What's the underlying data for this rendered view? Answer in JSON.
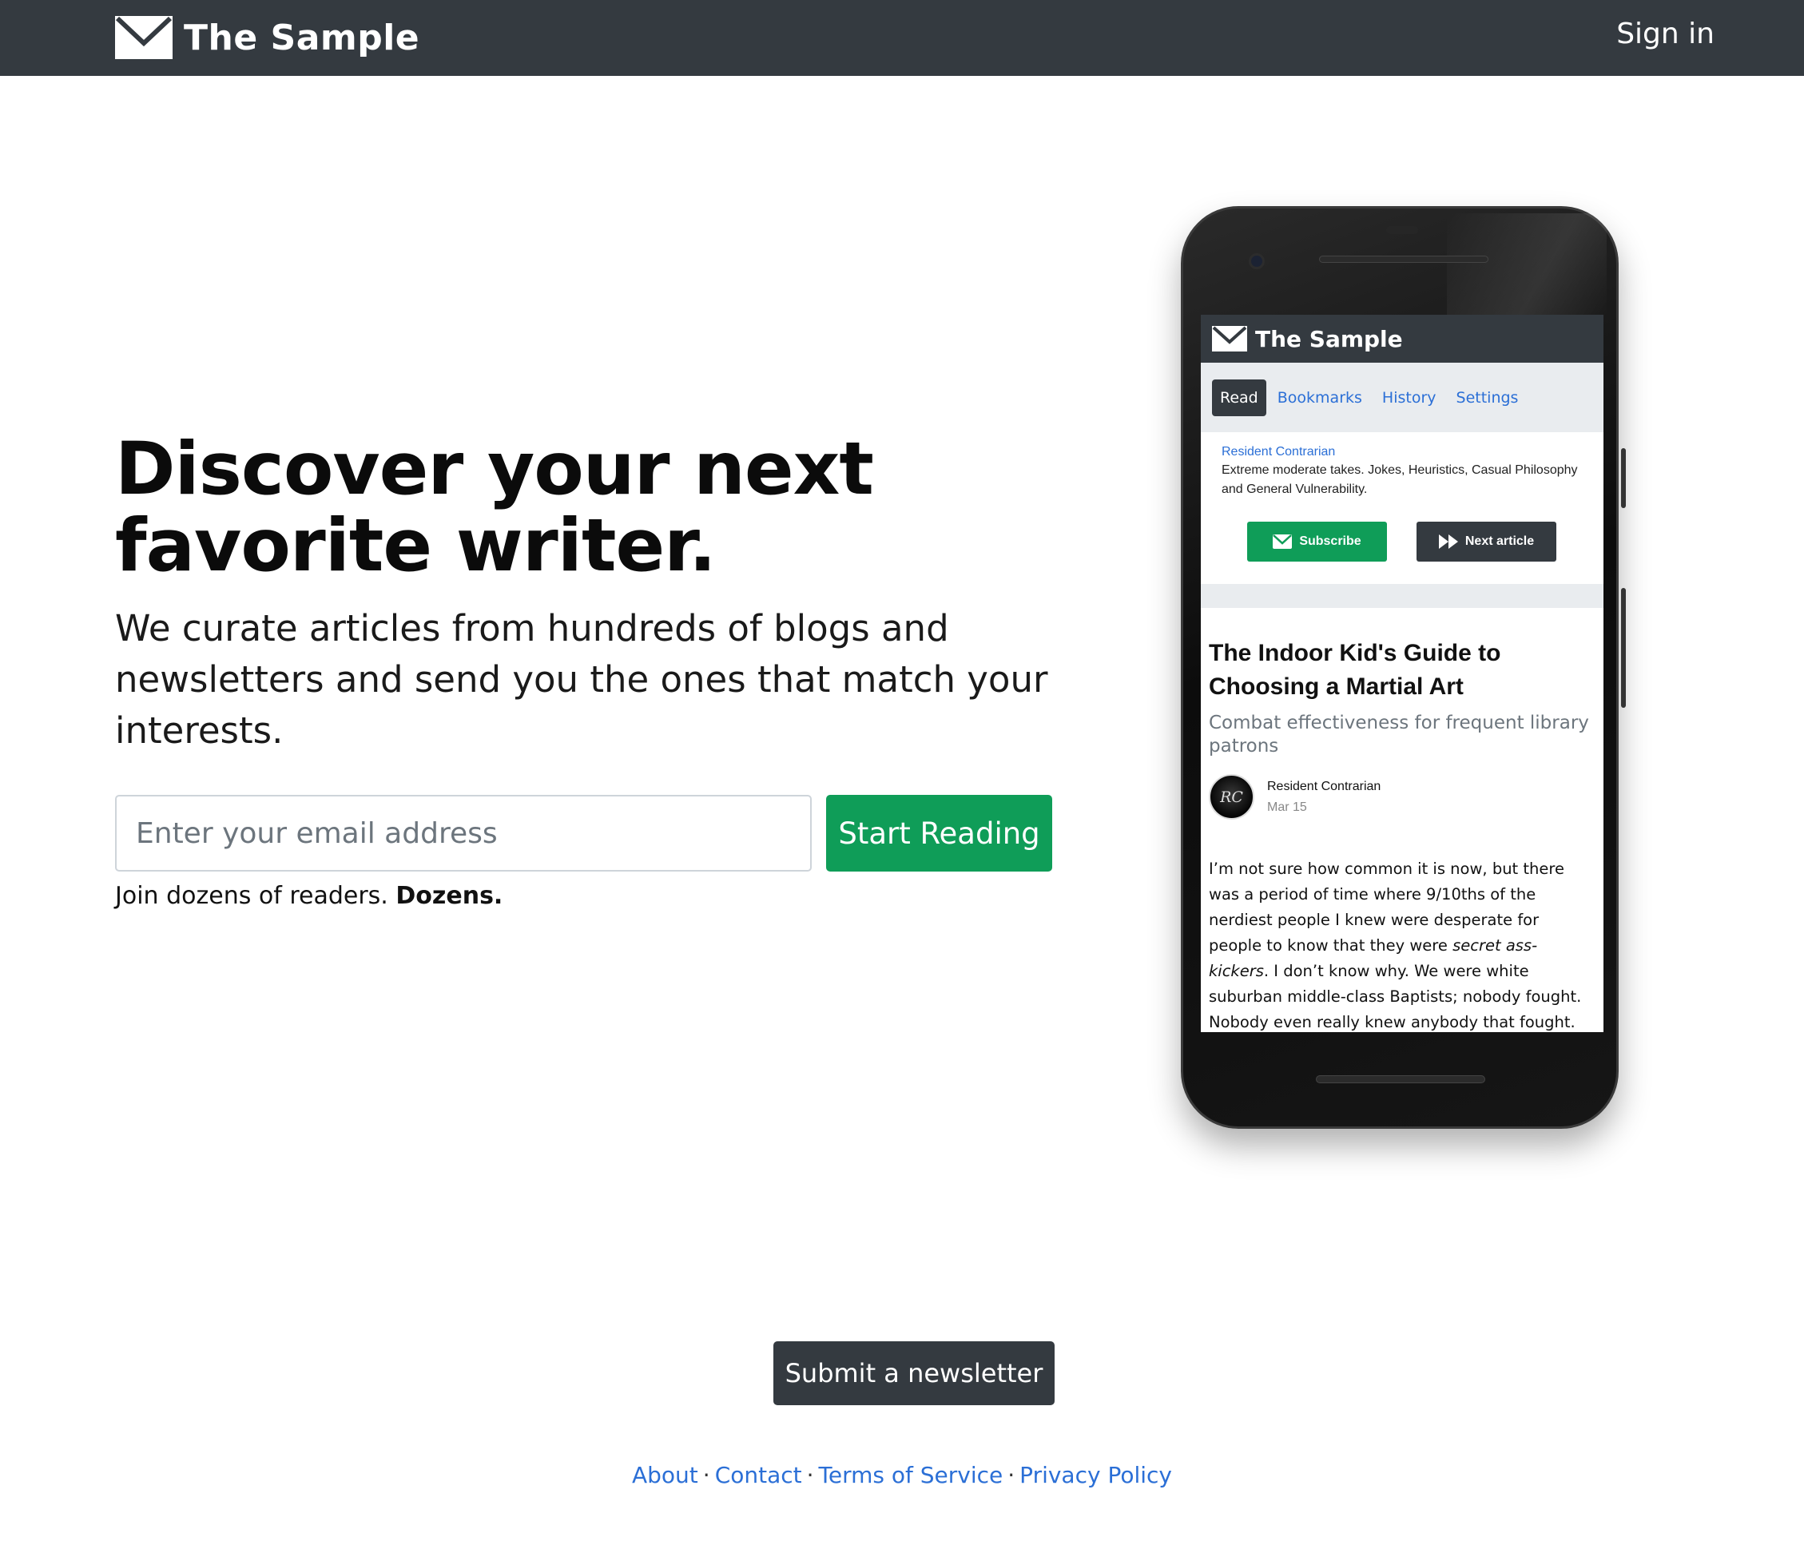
{
  "navbar": {
    "brand": "The Sample",
    "sign_in": "Sign in"
  },
  "hero": {
    "title_line1": "Discover your next",
    "title_line2": "favorite writer.",
    "subtitle": "We curate articles from hundreds of blogs and newsletters and send you the ones that match your interests.",
    "email_placeholder": "Enter your email address",
    "email_value": "",
    "start_button": "Start Reading",
    "join_text": "Join dozens of readers.",
    "join_bold": "Dozens."
  },
  "phone": {
    "brand": "The Sample",
    "tabs": [
      {
        "label": "Read",
        "active": true
      },
      {
        "label": "Bookmarks",
        "active": false
      },
      {
        "label": "History",
        "active": false
      },
      {
        "label": "Settings",
        "active": false
      }
    ],
    "publication": {
      "name": "Resident Contrarian",
      "description": "Extreme moderate takes. Jokes, Heuristics, Casual Philosophy and General Vulnerability.",
      "subscribe_label": "Subscribe",
      "next_label": "Next article"
    },
    "article": {
      "title": "The Indoor Kid's Guide to Choosing a Martial Art",
      "subtitle": "Combat effectiveness for frequent library patrons",
      "author": "Resident Contrarian",
      "date": "Mar 15",
      "avatar_initials": "RC",
      "body_before_italic": "I’m not sure how common it is now, but there was a period of time where 9/10ths of the nerdiest people I knew were desperate for people to know that they were ",
      "body_italic": "secret ass-kickers",
      "body_after_italic": ". I don’t know why. We were white suburban middle-class Baptists; nobody fought. Nobody even really knew anybody that fought."
    }
  },
  "submit_newsletter": "Submit a newsletter",
  "footer": {
    "links": [
      "About",
      "Contact",
      "Terms of Service",
      "Privacy Policy"
    ],
    "separator": "·"
  },
  "colors": {
    "navbar": "#343a40",
    "accent_green": "#0f9d58",
    "link_blue": "#2b6fd6",
    "tab_bar": "#e9ecef"
  },
  "icons": {
    "brand": "envelope-icon",
    "subscribe": "envelope-icon",
    "next": "fast-forward-icon"
  }
}
